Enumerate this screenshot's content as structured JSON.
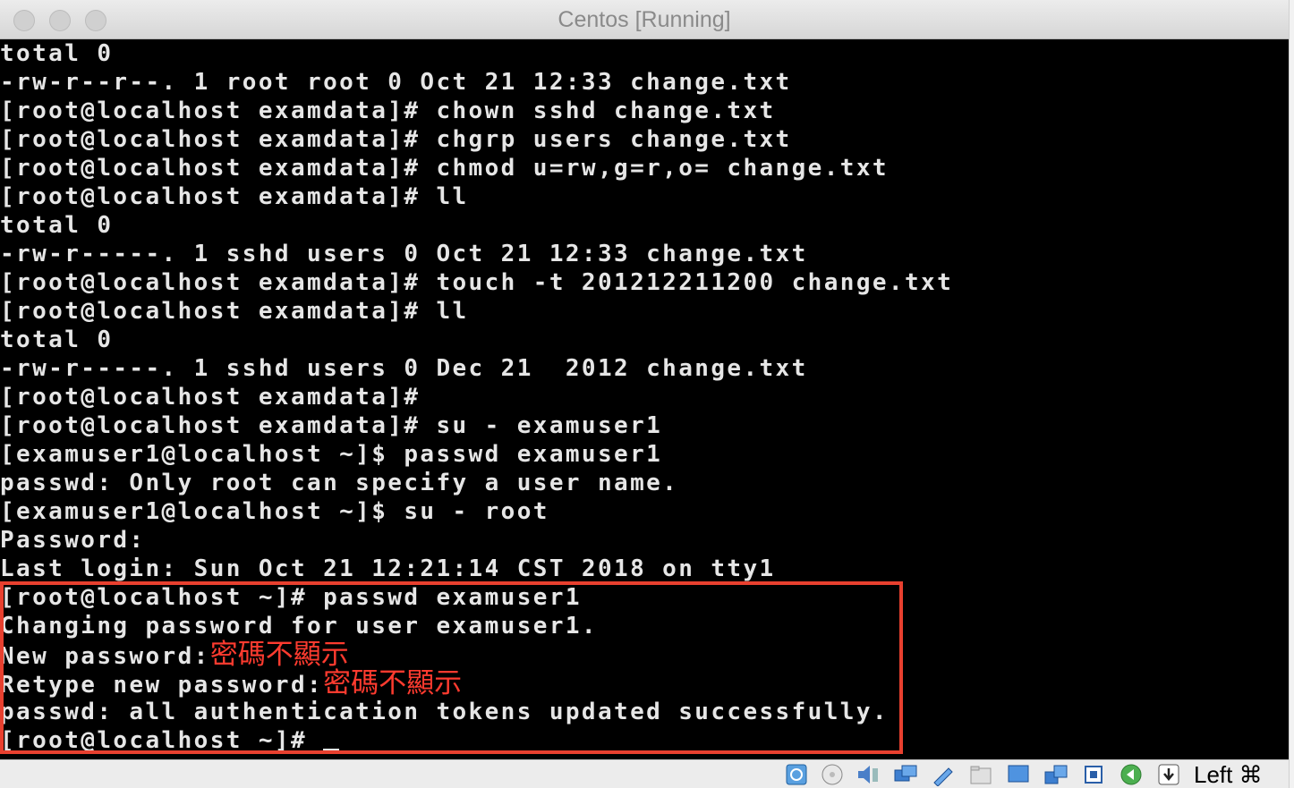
{
  "window": {
    "title": "Centos [Running]"
  },
  "terminal": {
    "lines": [
      "total 0",
      "-rw-r--r--. 1 root root 0 Oct 21 12:33 change.txt",
      "[root@localhost examdata]# chown sshd change.txt",
      "[root@localhost examdata]# chgrp users change.txt",
      "[root@localhost examdata]# chmod u=rw,g=r,o= change.txt",
      "[root@localhost examdata]# ll",
      "total 0",
      "-rw-r-----. 1 sshd users 0 Oct 21 12:33 change.txt",
      "[root@localhost examdata]# touch -t 201212211200 change.txt",
      "[root@localhost examdata]# ll",
      "total 0",
      "-rw-r-----. 1 sshd users 0 Dec 21  2012 change.txt",
      "[root@localhost examdata]#",
      "[root@localhost examdata]# su - examuser1",
      "[examuser1@localhost ~]$ passwd examuser1",
      "passwd: Only root can specify a user name.",
      "[examuser1@localhost ~]$ su - root",
      "Password:",
      "Last login: Sun Oct 21 12:21:14 CST 2018 on tty1",
      "[root@localhost ~]# passwd examuser1",
      "Changing password for user examuser1.",
      "New password:",
      "Retype new password:",
      "passwd: all authentication tokens updated successfully.",
      "[root@localhost ~]# "
    ],
    "annotation_new_password": "密碼不顯示",
    "annotation_retype_password": "密碼不顯示"
  },
  "statusbar": {
    "icons": [
      "hard-disk-icon",
      "optical-drive-icon",
      "audio-icon",
      "network-icon",
      "usb-icon",
      "shared-folders-icon",
      "display-icon",
      "video-capture-icon",
      "cpu-icon",
      "mouse-integration-icon",
      "host-key-arrow-icon"
    ],
    "host_key": "Left ⌘"
  },
  "colors": {
    "terminal_text": "#e6e6e6",
    "annotation": "#ff3b2f",
    "highlight_border": "#e8402f"
  }
}
